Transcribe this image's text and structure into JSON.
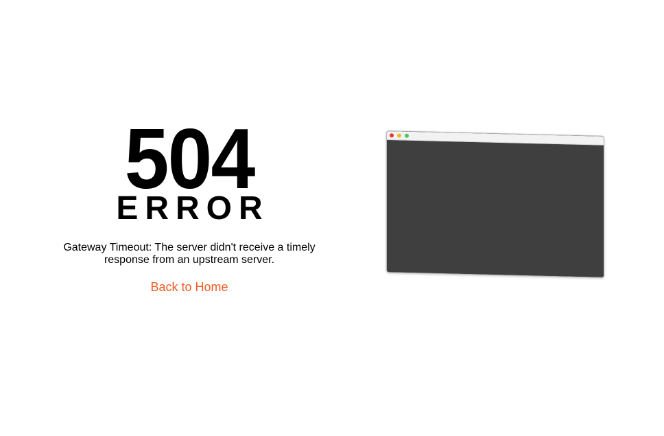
{
  "error": {
    "code": "504",
    "word": "ERROR",
    "message": "Gateway Timeout: The server didn't receive a timely response from an upstream server.",
    "link_label": "Back to Home"
  },
  "illustration": {
    "window_dots": [
      {
        "name": "close-dot",
        "color": "#e8382f"
      },
      {
        "name": "minimize-dot",
        "color": "#f1b72c"
      },
      {
        "name": "maximize-dot",
        "color": "#48c85b"
      }
    ],
    "screen_color": "#3f3f3f"
  },
  "colors": {
    "accent": "#f05a22",
    "text": "#000000"
  }
}
